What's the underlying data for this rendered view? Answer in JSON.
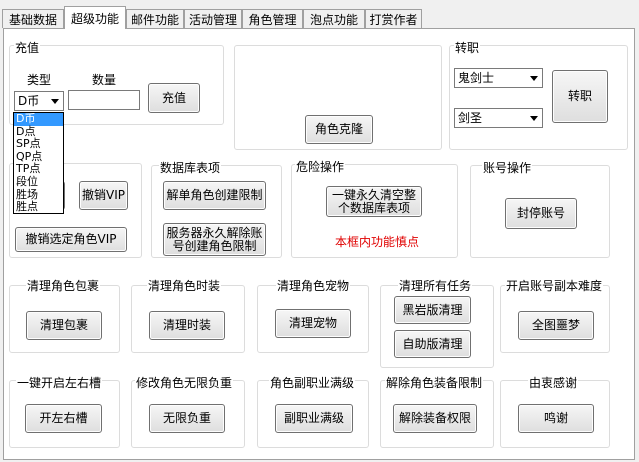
{
  "tabs": [
    "基础数据",
    "超级功能",
    "邮件功能",
    "活动管理",
    "角色管理",
    "泡点功能",
    "打赏作者"
  ],
  "recharge": {
    "group": "充值",
    "type_label": "类型",
    "amount_label": "数量",
    "type_value": "D币",
    "amount_value": "",
    "button": "充值",
    "options": [
      "D币",
      "D点",
      "SP点",
      "QP点",
      "TP点",
      "段位",
      "胜场",
      "胜点"
    ]
  },
  "clone": {
    "button": "角色克隆"
  },
  "job": {
    "group": "转职",
    "job_value": "鬼剑士",
    "sub_value": "剑圣",
    "button": "转职"
  },
  "vip": {
    "cancel_vip": "撤销VIP",
    "cancel_selected_vip": "撤销选定角色VIP"
  },
  "db": {
    "group": "数据库表项",
    "unlock_single": "解单角色创建限制",
    "unlock_server_line1": "服务器永久解除账",
    "unlock_server_line2": "号创建角色限制"
  },
  "danger": {
    "group": "危险操作",
    "clear_line1": "一键永久清空整",
    "clear_line2": "个数据库表项",
    "warning": "本框内功能慎点"
  },
  "account": {
    "group": "账号操作",
    "ban": "封停账号"
  },
  "row1": [
    {
      "group": "清理角色包裹",
      "button": "清理包裹"
    },
    {
      "group": "清理角色时装",
      "button": "清理时装"
    },
    {
      "group": "清理角色宠物",
      "button": "清理宠物"
    },
    {
      "group": "清理所有任务",
      "button": "黑岩版清理",
      "button2": "自助版清理"
    },
    {
      "group": "开启账号副本难度",
      "button": "全图噩梦"
    }
  ],
  "row2": [
    {
      "group": "一键开启左右槽",
      "button": "开左右槽"
    },
    {
      "group": "修改角色无限负重",
      "button": "无限负重"
    },
    {
      "group": "角色副职业满级",
      "button": "副职业满级"
    },
    {
      "group": "解除角色装备限制",
      "button": "解除装备权限"
    },
    {
      "group": "由衷感谢",
      "button": "鸣谢"
    }
  ],
  "colors": {
    "warning": "#e00000",
    "selection": "#3399ff"
  }
}
